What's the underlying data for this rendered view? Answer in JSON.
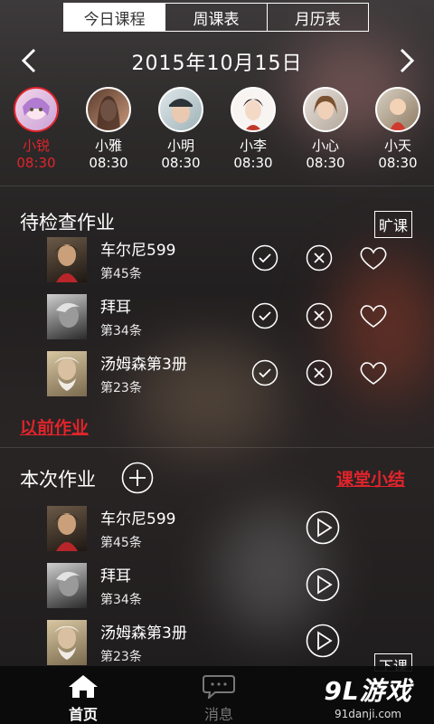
{
  "tabs": [
    "今日课程",
    "周课表",
    "月历表"
  ],
  "date": "2015年10月15日",
  "students": [
    {
      "name": "小锐",
      "time": "08:30"
    },
    {
      "name": "小雅",
      "time": "08:30"
    },
    {
      "name": "小明",
      "time": "08:30"
    },
    {
      "name": "小李",
      "time": "08:30"
    },
    {
      "name": "小心",
      "time": "08:30"
    },
    {
      "name": "小天",
      "time": "08:30"
    }
  ],
  "pending": {
    "title": "待检查作业",
    "absent_btn": "旷课",
    "items": [
      {
        "title": "车尔尼599",
        "sub": "第45条"
      },
      {
        "title": "拜耳",
        "sub": "第34条"
      },
      {
        "title": "汤姆森第3册",
        "sub": "第23条"
      }
    ],
    "previous_link": "以前作业"
  },
  "current": {
    "title": "本次作业",
    "summary_link": "课堂小结",
    "items": [
      {
        "title": "车尔尼599",
        "sub": "第45条"
      },
      {
        "title": "拜耳",
        "sub": "第34条"
      },
      {
        "title": "汤姆森第3册",
        "sub": "第23条"
      }
    ],
    "dismiss_btn": "下课"
  },
  "nav": {
    "home": "首页",
    "messages": "消息"
  },
  "watermark": {
    "brand": "9L游戏",
    "url": "91danji.com"
  },
  "colors": {
    "accent_red": "#e0242b"
  }
}
